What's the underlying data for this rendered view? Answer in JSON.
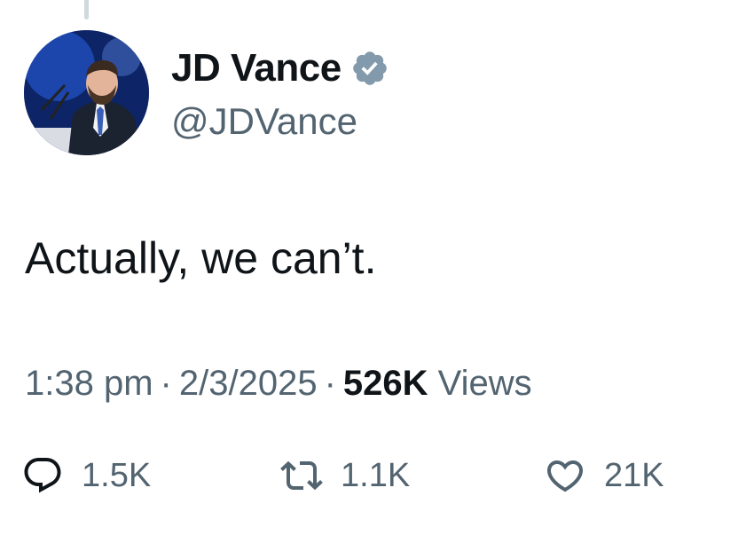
{
  "author": {
    "display_name": "JD Vance",
    "handle": "@JDVance",
    "verified": true,
    "verified_color": "#829aab"
  },
  "tweet": {
    "text": "Actually, we can’t."
  },
  "meta": {
    "time": "1:38 pm",
    "separator": "·",
    "date": "2/3/2025",
    "views_count": "526K",
    "views_label": "Views"
  },
  "actions": {
    "reply": {
      "icon": "reply-icon",
      "count": "1.5K"
    },
    "retweet": {
      "icon": "retweet-icon",
      "count": "1.1K"
    },
    "like": {
      "icon": "heart-icon",
      "count": "21K"
    }
  }
}
